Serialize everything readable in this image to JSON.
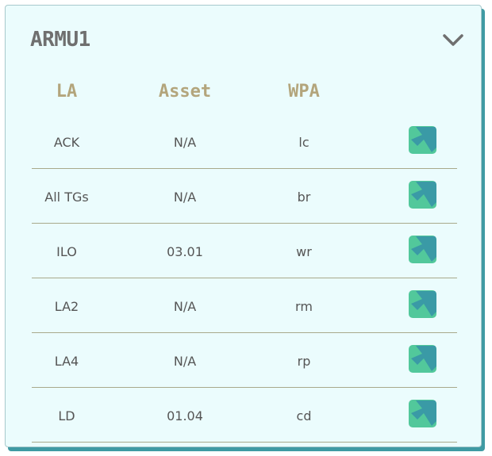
{
  "card": {
    "title": "ARMU1",
    "collapse_icon": "chevron-down-icon"
  },
  "table": {
    "headers": [
      "LA",
      "Asset",
      "WPA"
    ],
    "rows": [
      {
        "la": "ACK",
        "asset": "N/A",
        "wpa": "lc"
      },
      {
        "la": "All TGs",
        "asset": "N/A",
        "wpa": "br"
      },
      {
        "la": "ILO",
        "asset": "03.01",
        "wpa": "wr"
      },
      {
        "la": "LA2",
        "asset": "N/A",
        "wpa": "rm"
      },
      {
        "la": "LA4",
        "asset": "N/A",
        "wpa": "rp"
      },
      {
        "la": "LD",
        "asset": "01.04",
        "wpa": "cd"
      }
    ],
    "row_action_icon": "open-arrow-icon"
  },
  "colors": {
    "card_bg": "#ebfcfd",
    "card_shadow": "#3f9aa3",
    "header_text": "#b3a57c",
    "action_bg": "#52c89b",
    "action_arrow": "#3a9aa6"
  }
}
